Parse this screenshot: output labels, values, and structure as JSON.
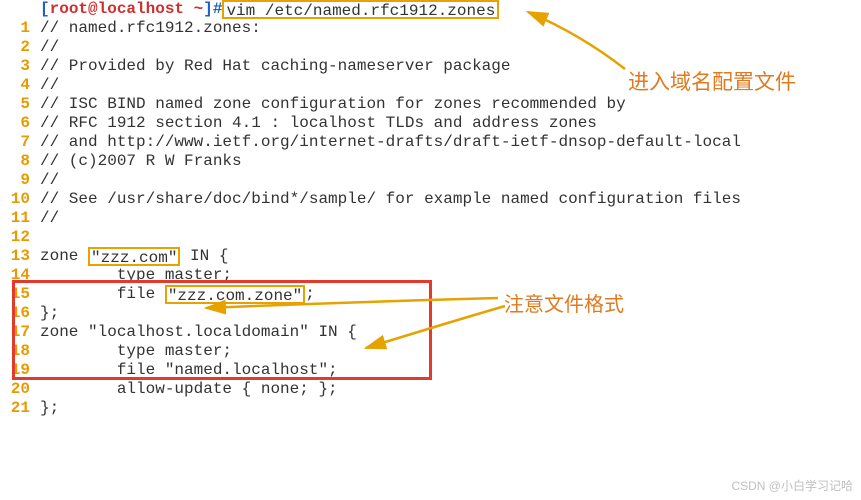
{
  "prompt": {
    "open_bracket": "[",
    "user_host": "root@localhost",
    "tilde": " ~",
    "close_bracket": "]",
    "hash": "#",
    "command": "vim /etc/named.rfc1912.zones"
  },
  "lines": {
    "l1": "// named.rfc1912.zones:",
    "l2": "//",
    "l3": "// Provided by Red Hat caching-nameserver package",
    "l4": "//",
    "l5": "// ISC BIND named zone configuration for zones recommended by",
    "l6": "// RFC 1912 section 4.1 : localhost TLDs and address zones",
    "l7": "// and http://www.ietf.org/internet-drafts/draft-ietf-dnsop-default-local",
    "l8": "// (c)2007 R W Franks",
    "l9": "//",
    "l10": "// See /usr/share/doc/bind*/sample/ for example named configuration files",
    "l11": "//",
    "l12": "",
    "l13a": "zone ",
    "l13b": "\"zzz.com\"",
    "l13c": " IN {",
    "l14": "        type master;",
    "l15a": "        file ",
    "l15b": "\"zzz.com.zone\"",
    "l15c": ";",
    "l16": "};",
    "l17": "zone \"localhost.localdomain\" IN {",
    "l18": "        type master;",
    "l19": "        file \"named.localhost\";",
    "l20": "        allow-update { none; };",
    "l21": "};"
  },
  "lineno": {
    "n1": "1",
    "n2": "2",
    "n3": "3",
    "n4": "4",
    "n5": "5",
    "n6": "6",
    "n7": "7",
    "n8": "8",
    "n9": "9",
    "n10": "10",
    "n11": "11",
    "n12": "12",
    "n13": "13",
    "n14": "14",
    "n15": "15",
    "n16": "16",
    "n17": "17",
    "n18": "18",
    "n19": "19",
    "n20": "20",
    "n21": "21"
  },
  "annot": {
    "a1": "进入域名配置文件",
    "a2": "注意文件格式"
  },
  "watermark": "CSDN @小白学习记哈"
}
